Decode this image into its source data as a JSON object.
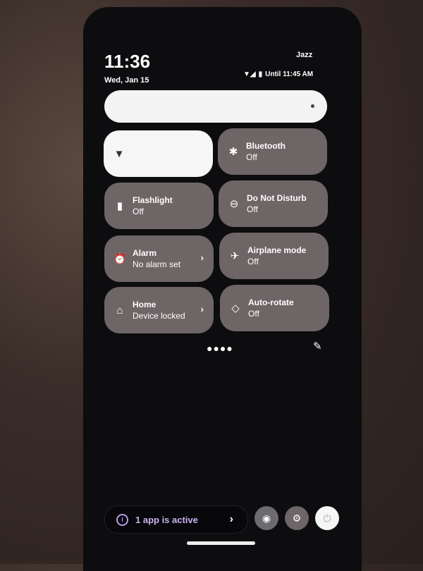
{
  "status_bar": {
    "time": "11:36",
    "date": "Wed, Jan 15",
    "carrier": "Jazz",
    "status_text": "Until 11:45 AM"
  },
  "brightness": {
    "level_percent": 95
  },
  "tiles": [
    {
      "title": "",
      "subtitle": "",
      "icon": "wifi-icon",
      "active": true
    },
    {
      "title": "Bluetooth",
      "subtitle": "Off",
      "icon": "bluetooth-icon"
    },
    {
      "title": "Flashlight",
      "subtitle": "Off",
      "icon": "flashlight-icon"
    },
    {
      "title": "Do Not Disturb",
      "subtitle": "Off",
      "icon": "dnd-icon"
    },
    {
      "title": "Alarm",
      "subtitle": "No alarm set",
      "icon": "alarm-icon",
      "chevron": "›"
    },
    {
      "title": "Airplane mode",
      "subtitle": "Off",
      "icon": "airplane-icon"
    },
    {
      "title": "Home",
      "subtitle": "Device locked",
      "icon": "home-icon",
      "chevron": "›"
    },
    {
      "title": "Auto-rotate",
      "subtitle": "Off",
      "icon": "rotate-icon"
    }
  ],
  "footer": {
    "active_apps": "1 app is active",
    "chevron": "›",
    "accent": "#c7b2f0"
  }
}
